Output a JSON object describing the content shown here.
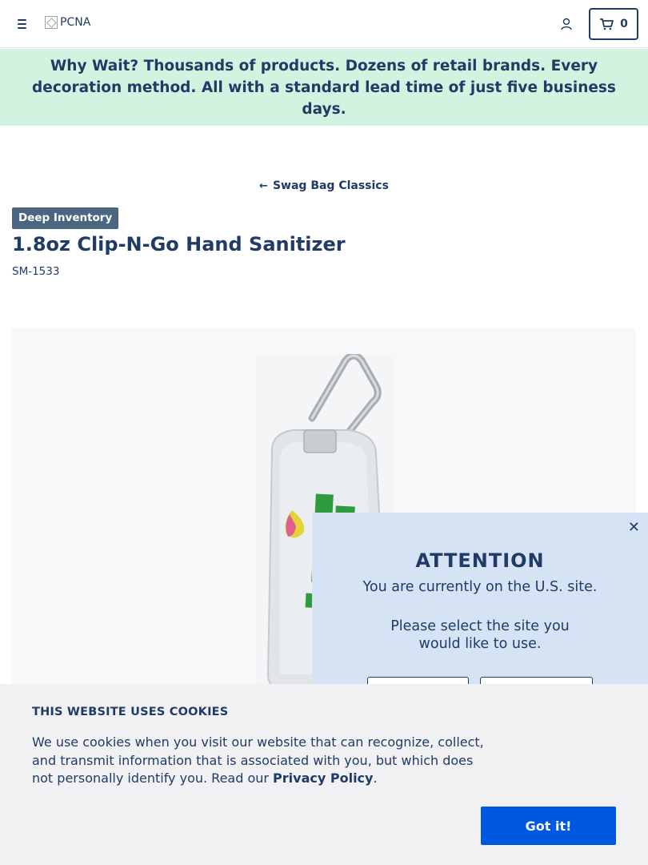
{
  "header": {
    "logo_alt": "PCNA",
    "cart_count": "0"
  },
  "promo": {
    "lead": "Why Wait?",
    "text": "Thousands of products. Dozens of retail brands. Every decoration method. All with a standard lead time of just five business days."
  },
  "breadcrumb": {
    "back_label": "Swag Bag Classics"
  },
  "product": {
    "badge": "Deep Inventory",
    "name": "1.8oz Clip-N-Go Hand Sanitizer",
    "sku": "SM-1533"
  },
  "attention_modal": {
    "title": "ATTENTION",
    "line1": "You are currently on the U.S. site.",
    "line2": "Please select the site you",
    "line3": "would like to use.",
    "close_icon": "close-icon"
  },
  "cookie_banner": {
    "title": "THIS WEBSITE USES COOKIES",
    "body": "We use cookies when you visit our website that can recognize, collect, and transmit information that is associated with you, but which does not personally identify you. Read our ",
    "link_label": "Privacy Policy",
    "suffix": ".",
    "button_label": "Got it!"
  },
  "colors": {
    "navy": "#1f3b66",
    "promo_bg": "#d3f3e0",
    "modal_bg": "#d6e3f4",
    "cookie_bg": "#f1f1f3",
    "cta_blue": "#0057e0",
    "badge_bg": "#4a6680"
  }
}
